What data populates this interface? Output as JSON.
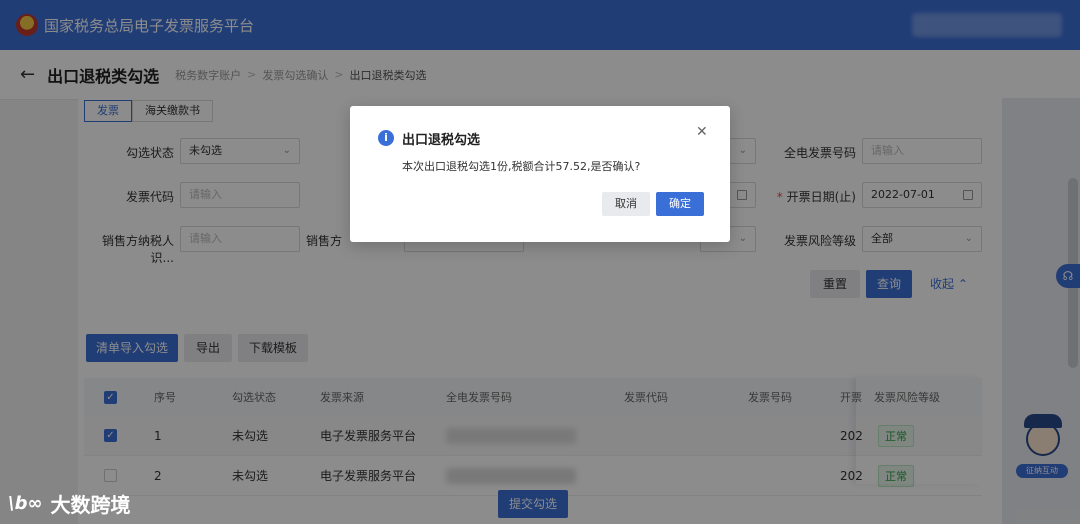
{
  "header": {
    "app_title": "国家税务总局电子发票服务平台"
  },
  "page": {
    "title": "出口退税类勾选",
    "breadcrumb": [
      "税务数字账户",
      "发票勾选确认",
      "出口退税类勾选"
    ]
  },
  "tabs": [
    {
      "label": "发票",
      "active": true
    },
    {
      "label": "海关缴款书",
      "active": false
    }
  ],
  "filters": {
    "select_status": {
      "label": "勾选状态",
      "value": "未勾选"
    },
    "invoice_number": {
      "label": "全电发票号码",
      "placeholder": "请输入"
    },
    "invoice_code": {
      "label": "发票代码",
      "placeholder": "请输入"
    },
    "issue_date_end": {
      "label": "开票日期(止)",
      "value": "2022-07-01"
    },
    "seller_tax_id": {
      "label": "销售方纳税人识...",
      "placeholder": "请输入"
    },
    "seller_name": {
      "label": "销售方"
    },
    "risk_level": {
      "label": "发票风险等级",
      "value": "全部"
    },
    "reset_label": "重置",
    "query_label": "查询",
    "collapse_label": "收起"
  },
  "actions": {
    "import_label": "清单导入勾选",
    "export_label": "导出",
    "template_label": "下载模板",
    "submit_label": "提交勾选"
  },
  "table": {
    "columns": [
      "序号",
      "勾选状态",
      "发票来源",
      "全电发票号码",
      "发票代码",
      "发票号码",
      "开票",
      "发票风险等级"
    ],
    "rows": [
      {
        "index": "1",
        "status": "未勾选",
        "source": "电子发票服务平台",
        "date": "202",
        "risk": "正常",
        "checked": true
      },
      {
        "index": "2",
        "status": "未勾选",
        "source": "电子发票服务平台",
        "date": "202",
        "risk": "正常",
        "checked": false
      }
    ]
  },
  "mascot": {
    "label": "征纳互动"
  },
  "modal": {
    "title": "出口退税勾选",
    "message": "本次出口退税勾选1份,税额合计57.52,是否确认?",
    "cancel_label": "取消",
    "confirm_label": "确定"
  },
  "watermark": {
    "logo": "\\b∞",
    "text": "大数跨境"
  },
  "icons": {
    "back": "arrow-left-icon",
    "info": "info-icon",
    "close": "close-icon"
  },
  "colors": {
    "primary": "#3b6fd8",
    "overlay": "rgba(0,0,0,0.45)",
    "ok_tag": "#2e9e4b"
  }
}
